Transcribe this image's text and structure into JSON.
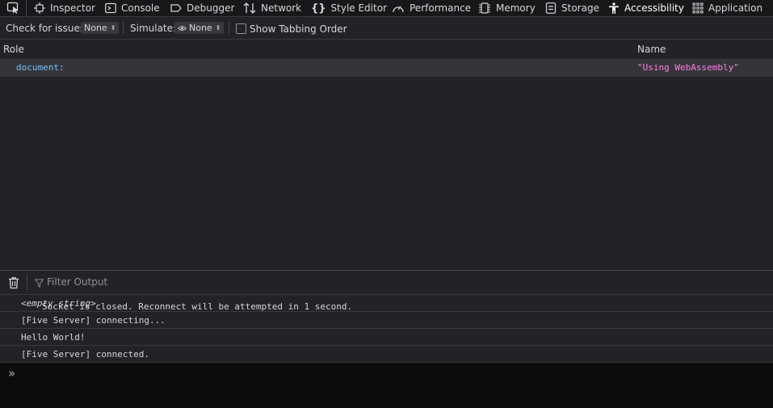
{
  "toolbar": {
    "tabs": [
      {
        "label": "Inspector"
      },
      {
        "label": "Console"
      },
      {
        "label": "Debugger"
      },
      {
        "label": "Network"
      },
      {
        "label": "Style Editor"
      },
      {
        "label": "Performance"
      },
      {
        "label": "Memory"
      },
      {
        "label": "Storage"
      },
      {
        "label": "Accessibility"
      },
      {
        "label": "Application"
      }
    ],
    "active_tab": "Accessibility"
  },
  "filters": {
    "check_label": "Check for issues:",
    "check_value": "None",
    "simulate_label": "Simulate:",
    "simulate_value": "None",
    "tabbing_label": "Show Tabbing Order"
  },
  "tree": {
    "col_role": "Role",
    "col_name": "Name",
    "rows": [
      {
        "role": "document:",
        "name": "\"Using WebAssembly\""
      }
    ]
  },
  "console": {
    "filter_placeholder": "Filter Output",
    "messages": [
      {
        "text": "Socket is closed. Reconnect will be attempted in 1 second.",
        "extra": "<empty string>"
      },
      {
        "text": "[Five Server] connecting..."
      },
      {
        "text": "Hello World!"
      },
      {
        "text": "[Five Server] connected."
      }
    ],
    "prompt_icon": "»"
  },
  "colors": {
    "accent_role": "#75bfff",
    "accent_name": "#ff7de9",
    "background": "#232327"
  }
}
